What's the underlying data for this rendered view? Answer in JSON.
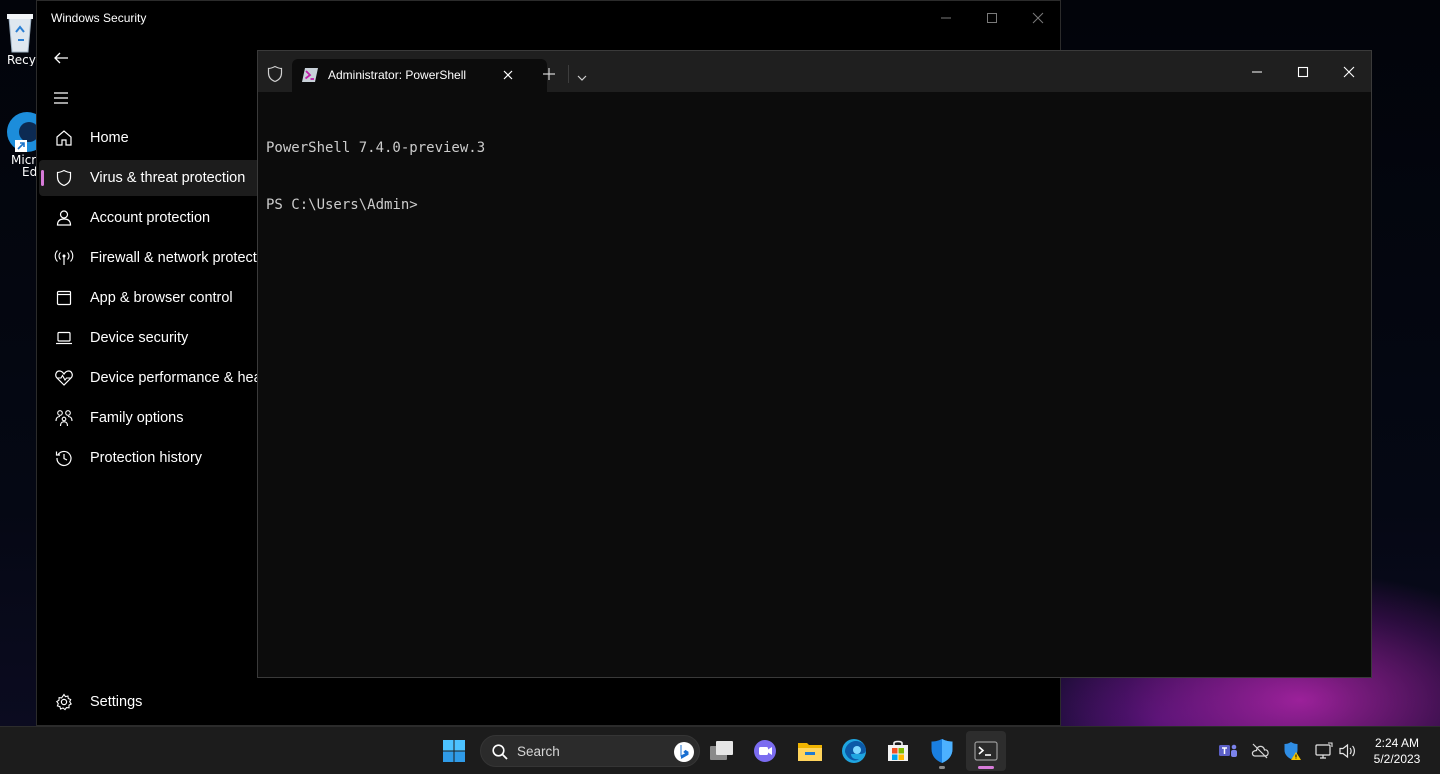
{
  "desktop": {
    "icons": [
      {
        "name": "recycle-bin",
        "label": "Recyc"
      },
      {
        "name": "microsoft-edge",
        "label_line1": "Micro",
        "label_line2": "Ed"
      }
    ]
  },
  "security_window": {
    "title": "Windows Security",
    "nav_items": [
      {
        "id": "home",
        "label": "Home",
        "icon": "home-icon"
      },
      {
        "id": "virus",
        "label": "Virus & threat protection",
        "icon": "shield-icon",
        "selected": true
      },
      {
        "id": "account",
        "label": "Account protection",
        "icon": "person-icon"
      },
      {
        "id": "firewall",
        "label": "Firewall & network protection",
        "icon": "antenna-icon"
      },
      {
        "id": "app-browser",
        "label": "App & browser control",
        "icon": "app-window-icon"
      },
      {
        "id": "device-security",
        "label": "Device security",
        "icon": "laptop-icon"
      },
      {
        "id": "device-performance",
        "label": "Device performance & health",
        "icon": "heart-pulse-icon"
      },
      {
        "id": "family",
        "label": "Family options",
        "icon": "family-icon"
      },
      {
        "id": "history",
        "label": "Protection history",
        "icon": "history-icon"
      }
    ],
    "settings_label": "Settings",
    "accent_color": "#d77bd9"
  },
  "terminal": {
    "tab_title": "Administrator: PowerShell",
    "lines": [
      "PowerShell 7.4.0-preview.3",
      "PS C:\\Users\\Admin>"
    ]
  },
  "taskbar": {
    "search_placeholder": "Search",
    "apps": [
      "start-icon",
      "task-view-icon",
      "teams-chat-icon",
      "file-explorer-icon",
      "edge-icon",
      "store-icon",
      "defender-icon",
      "terminal-icon"
    ],
    "clock": {
      "time": "2:24 AM",
      "date": "5/2/2023"
    }
  }
}
